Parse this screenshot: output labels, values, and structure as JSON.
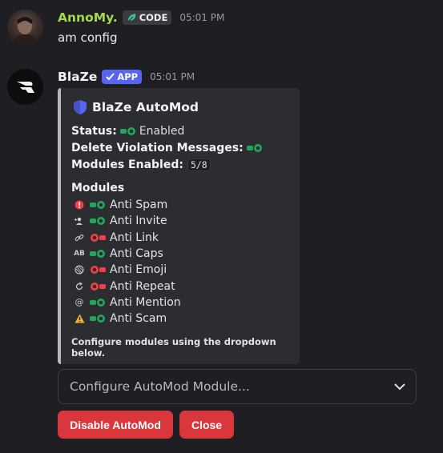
{
  "messages": [
    {
      "username": "AnnoMy.",
      "username_color": "#a3d94a",
      "badge": "CODE",
      "time": "05:01 PM",
      "content": "am config"
    },
    {
      "username": "BlaZe",
      "username_color": "#f2f3f5",
      "badge": "APP",
      "time": "05:01 PM"
    }
  ],
  "embed": {
    "title": "BlaZe AutoMod",
    "status_label": "Status:",
    "status_value": "Enabled",
    "delete_label": "Delete Violation Messages:",
    "modules_enabled_label": "Modules Enabled:",
    "modules_enabled_value": "5/8",
    "modules_heading": "Modules",
    "modules": [
      {
        "name": "Anti Spam",
        "icon": "exclamation-icon",
        "enabled": true
      },
      {
        "name": "Anti Invite",
        "icon": "user-plus-icon",
        "enabled": true
      },
      {
        "name": "Anti Link",
        "icon": "link-icon",
        "enabled": false
      },
      {
        "name": "Anti Caps",
        "icon": "caps-icon",
        "enabled": true
      },
      {
        "name": "Anti Emoji",
        "icon": "emoji-icon",
        "enabled": false
      },
      {
        "name": "Anti Repeat",
        "icon": "repeat-icon",
        "enabled": false
      },
      {
        "name": "Anti Mention",
        "icon": "at-icon",
        "enabled": true
      },
      {
        "name": "Anti Scam",
        "icon": "warning-icon",
        "enabled": true
      }
    ],
    "footer": "Configure modules using the dropdown below."
  },
  "select": {
    "placeholder": "Configure AutoMod Module..."
  },
  "buttons": {
    "disable": "Disable AutoMod",
    "close": "Close"
  },
  "colors": {
    "toggle_on": "#23a55a",
    "toggle_off": "#f23f43",
    "button_danger": "#da373c",
    "app_badge": "#5865f2"
  }
}
